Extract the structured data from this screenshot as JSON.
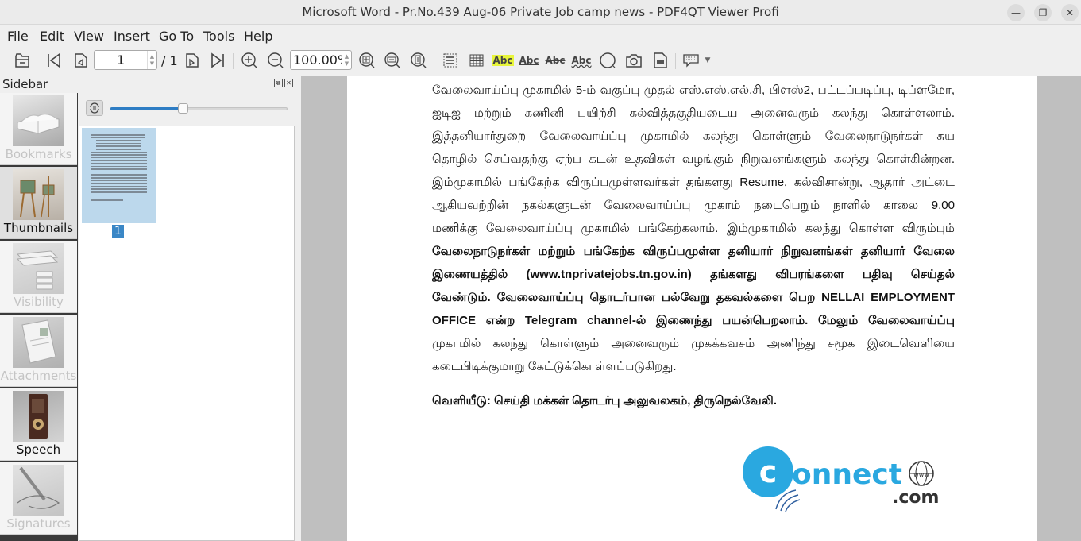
{
  "window": {
    "title": "Microsoft Word - Pr.No.439 Aug-06 Private Job camp news - PDF4QT Viewer Profi",
    "minimize": "—",
    "restore": "❐",
    "close": "✕"
  },
  "menu": [
    "File",
    "Edit",
    "View",
    "Insert",
    "Go To",
    "Tools",
    "Help"
  ],
  "toolbar": {
    "page_current": "1",
    "page_total": "/ 1",
    "zoom": "100.00%",
    "text_tools": [
      "Abc",
      "Abc",
      "Abc",
      "Abc"
    ],
    "highlight_color": "#e8f53a",
    "icons": [
      "open-icon",
      "first-page-icon",
      "previous-page-icon",
      "next-page-icon",
      "last-page-icon",
      "zoom-in-icon",
      "zoom-out-icon",
      "fit-page-icon",
      "fit-width-icon",
      "fit-height-icon",
      "select-text-icon",
      "select-table-icon",
      "highlight-icon",
      "underline-icon",
      "strikeout-icon",
      "squiggly-icon",
      "magnifier-icon",
      "screenshot-icon",
      "extract-image-icon",
      "comment-icon"
    ]
  },
  "sidebar": {
    "title": "Sidebar",
    "tabs": [
      {
        "label": "Bookmarks",
        "enabled": false
      },
      {
        "label": "Thumbnails",
        "enabled": true,
        "active": true
      },
      {
        "label": "Visibility",
        "enabled": false
      },
      {
        "label": "Attachments",
        "enabled": false
      },
      {
        "label": "Speech",
        "enabled": true
      },
      {
        "label": "Signatures",
        "enabled": false
      }
    ],
    "thumbnail_zoom_fraction": 0.41,
    "thumbnails": [
      {
        "page": "1"
      }
    ]
  },
  "document": {
    "lines": [
      "வேலைவாய்ப்பு முகாமில் 5-ம் வகுப்பு முதல் எஸ்.எஸ்.எல்.சி, பிளஸ்2, பட்டப்படிப்பு, டிப்ளமோ,",
      "ஐடிஐ மற்றும் கணினி பயிற்சி கல்வித்தகுதியடைய அனைவரும் கலந்து கொள்ளலாம்.",
      "இத்தனியார்துறை வேலைவாய்ப்பு முகாமில் கலந்து கொள்ளும் வேலைநாடுநர்கள் சுய",
      "தொழில் செய்வதற்கு ஏற்ப கடன் உதவிகள் வழங்கும் நிறுவனங்களும் கலந்து கொள்கின்றன.",
      "இம்முகாமில் பங்கேற்க விருப்பமுள்ளவர்கள் தங்களது Resume, கல்விசான்று, ஆதார் அட்டை",
      "ஆகியவற்றின் நகல்களுடன்  வேலைவாய்ப்பு முகாம் நடைபெறும் நாளில் காலை 9.00",
      "மணிக்கு வேலைவாய்ப்பு முகாமில் பங்கேற்கலாம். இம்முகாமில் கலந்து கொள்ள விரும்பும்",
      "வேலைநாடுநர்கள்  மற்றும் பங்கேற்க விருப்பமுள்ள தனியார் நிறுவனங்கள் தனியார் வேலை",
      "இணையத்தில் (www.tnprivatejobs.tn.gov.in) தங்களது விபரங்களை பதிவு செய்தல்",
      "வேண்டும். வேலைவாய்ப்பு தொடர்பான பல்வேறு தகவல்களை பெற NELLAI EMPLOYMENT",
      "OFFICE என்ற Telegram channel-ல் இணைந்து பயன்பெறலாம். மேலும் வேலைவாய்ப்பு",
      "முகாமில் கலந்து கொள்ளும் அனைவரும் முகக்கவசம் அணிந்து சமூக இடைவெளியை",
      "கடைபிடிக்குமாறு கேட்டுக்கொள்ளப்படுகிறது."
    ],
    "release": "வெளியீடு: செய்தி மக்கள் தொடர்பு அலுவலகம், திருநெல்வேலி.",
    "logo": {
      "main": "onnect",
      "suffix": ".com",
      "globe_text": "www",
      "color": "#2aa8e0"
    }
  }
}
